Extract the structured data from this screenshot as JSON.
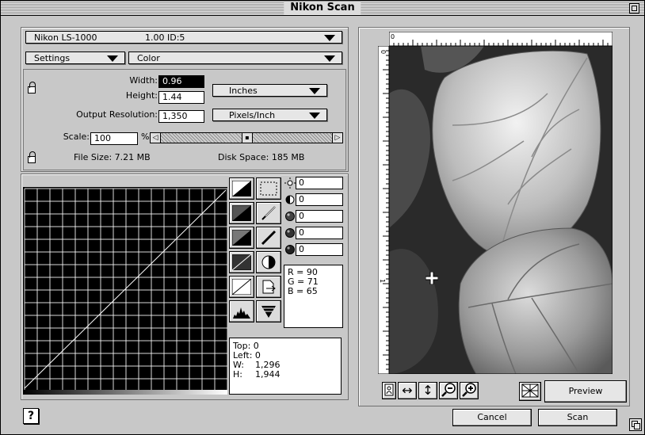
{
  "window": {
    "title": "Nikon Scan"
  },
  "scanner": {
    "device": "Nikon  LS-1000",
    "version": "1.00 ID:5"
  },
  "settings": {
    "menu_label": "Settings",
    "mode": "Color"
  },
  "dimensions": {
    "width_label": "Width:",
    "width_value": "0.96",
    "height_label": "Height:",
    "height_value": "1.44",
    "units": "Inches",
    "resolution_label": "Output Resolution:",
    "resolution_value": "1,350",
    "resolution_units": "Pixels/Inch",
    "scale_label": "Scale:",
    "scale_value": "100",
    "scale_unit": "%",
    "file_size": "File Size: 7.21 MB",
    "disk_space": "Disk Space: 185 MB"
  },
  "adjustments": [
    {
      "icon": "brightness-icon",
      "value": "0"
    },
    {
      "icon": "contrast-icon",
      "value": "0"
    },
    {
      "icon": "red-balance-icon",
      "value": "0"
    },
    {
      "icon": "green-balance-icon",
      "value": "0"
    },
    {
      "icon": "blue-balance-icon",
      "value": "0"
    }
  ],
  "color_readout": {
    "r": "R = 90",
    "g": "G = 71",
    "b": "B = 65"
  },
  "crop_info": {
    "top": "Top:  0",
    "left": "Left:  0",
    "w_label": "W:",
    "w_value": "1,296",
    "h_label": "H:",
    "h_value": "1,944"
  },
  "buttons": {
    "preview": "Preview",
    "cancel": "Cancel",
    "scan": "Scan"
  },
  "ruler": {
    "zero_top": "0",
    "zero_left": "0",
    "one": "1"
  }
}
